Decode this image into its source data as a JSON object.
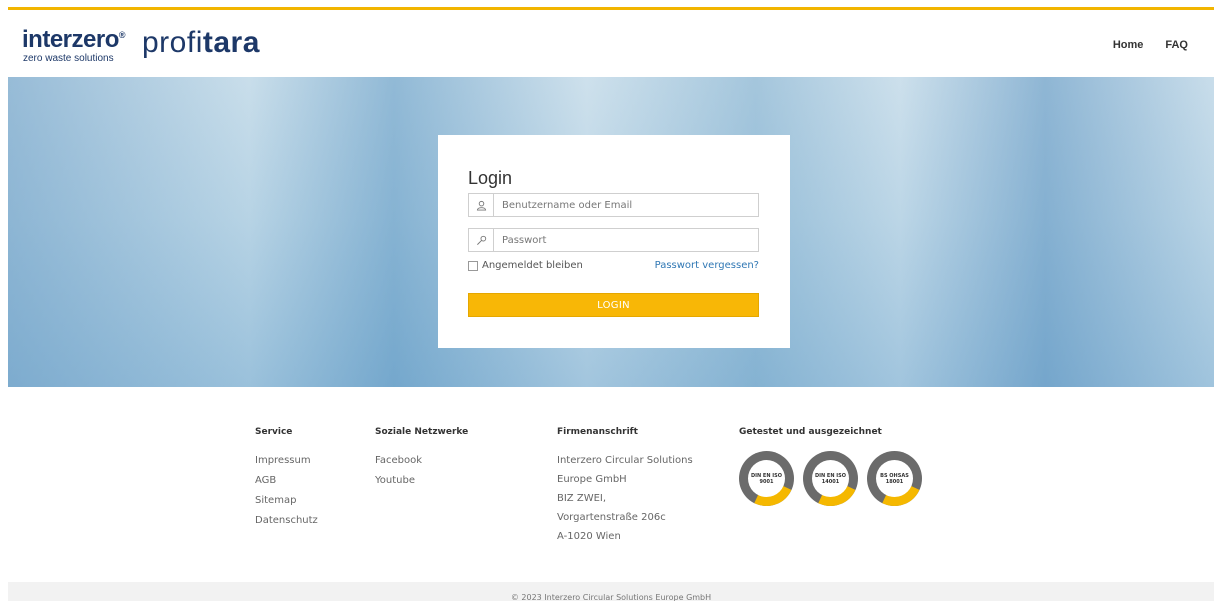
{
  "header": {
    "brand_name": "interzero",
    "brand_reg": "®",
    "brand_tagline": "zero waste solutions",
    "product_prefix": "profi",
    "product_suffix": "tara",
    "nav": [
      {
        "label": "Home"
      },
      {
        "label": "FAQ"
      }
    ]
  },
  "login": {
    "title": "Login",
    "username_placeholder": "Benutzername oder Email",
    "password_placeholder": "Passwort",
    "remember_label": "Angemeldet bleiben",
    "forgot_label": "Passwort vergessen?",
    "submit_label": "LOGIN",
    "remember_checked": false
  },
  "footer": {
    "service": {
      "heading": "Service",
      "items": [
        "Impressum",
        "AGB",
        "Sitemap",
        "Datenschutz"
      ]
    },
    "social": {
      "heading": "Soziale Netzwerke",
      "items": [
        "Facebook",
        "Youtube"
      ]
    },
    "address": {
      "heading": "Firmenanschrift",
      "lines": [
        "Interzero Circular Solutions Europe GmbH",
        "BIZ ZWEI,",
        "Vorgartenstraße 206c",
        "A-1020 Wien"
      ]
    },
    "certifications": {
      "heading": "Getestet und ausgezeichnet",
      "seals": [
        {
          "line1": "DIN EN ISO",
          "line2": "9001"
        },
        {
          "line1": "DIN EN ISO",
          "line2": "14001"
        },
        {
          "line1": "BS OHSAS",
          "line2": "18001"
        }
      ]
    },
    "copyright": "© 2023 Interzero Circular Solutions Europe GmbH"
  },
  "colors": {
    "accent": "#f8b706",
    "brand_blue": "#1d3868",
    "link": "#2f77b4"
  }
}
